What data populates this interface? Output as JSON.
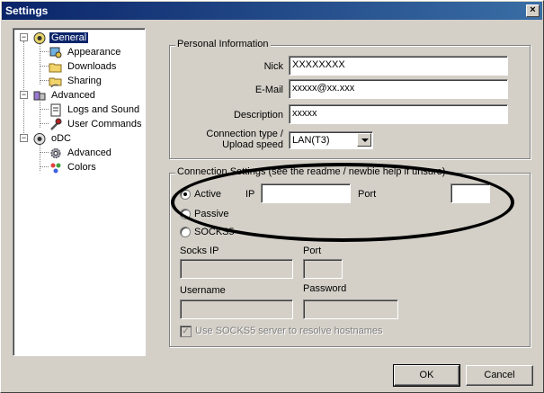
{
  "window": {
    "title": "Settings",
    "close_glyph": "×"
  },
  "tree": {
    "items": [
      {
        "label": "General",
        "icon": "globe-icon",
        "selected": true
      },
      {
        "label": "Appearance",
        "icon": "appearance-icon"
      },
      {
        "label": "Downloads",
        "icon": "folder-icon"
      },
      {
        "label": "Sharing",
        "icon": "shared-folder-icon"
      },
      {
        "label": "Advanced",
        "icon": "advanced-icon"
      },
      {
        "label": "Logs and Sound",
        "icon": "log-file-icon"
      },
      {
        "label": "User Commands",
        "icon": "wrench-icon"
      },
      {
        "label": "oDC",
        "icon": "odc-icon"
      },
      {
        "label": "Advanced",
        "icon": "gear-icon"
      },
      {
        "label": "Colors",
        "icon": "colors-icon"
      }
    ],
    "expander_symbol": "−"
  },
  "personal": {
    "title": "Personal Information",
    "nick_label": "Nick",
    "nick_value": "XXXXXXXX",
    "email_label": "E-Mail",
    "email_value": "xxxxx@xx.xxx",
    "description_label": "Description",
    "description_value": "xxxxx",
    "connection_label": "Connection type / Upload speed",
    "connection_value": "LAN(T3)"
  },
  "connection": {
    "title": "Connection Settings (see the readme / newbie help if unsure)",
    "active_label": "Active",
    "ip_label": "IP",
    "ip_value": "",
    "port_label": "Port",
    "port_value": "",
    "passive_label": "Passive",
    "socks5_label": "SOCKS5",
    "socks_ip_label": "Socks IP",
    "socks_port_label": "Port",
    "username_label": "Username",
    "password_label": "Password",
    "resolve_label": "Use SOCKS5 server to resolve hostnames",
    "resolve_checked": true,
    "selected_mode": "Active"
  },
  "buttons": {
    "ok": "OK",
    "cancel": "Cancel"
  }
}
